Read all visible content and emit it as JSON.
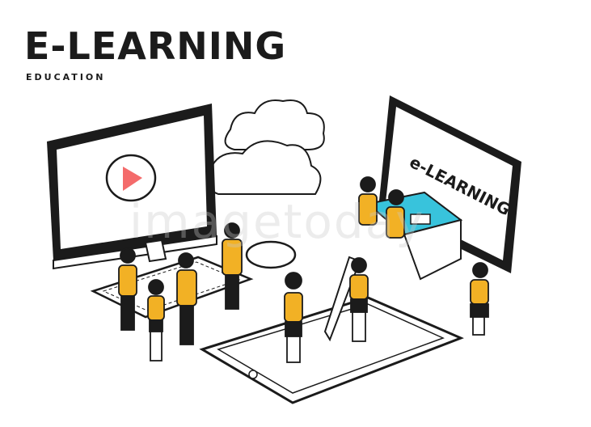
{
  "header": {
    "title": "E-LEARNING",
    "subtitle": "EDUCATION"
  },
  "tablet_screen_text": "e-LEARNING",
  "watermark": "imagetoday",
  "colors": {
    "ink": "#1b1b1b",
    "uniform": "#f2b125",
    "desk": "#38c3dc",
    "play": "#f46b6b"
  }
}
